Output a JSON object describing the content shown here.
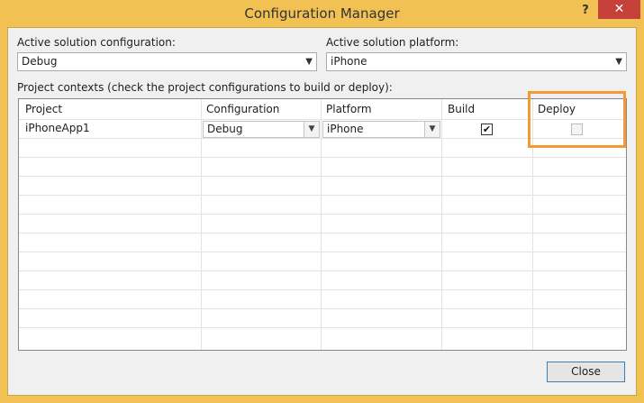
{
  "window": {
    "title": "Configuration Manager",
    "help_label": "?",
    "close_label": "✕"
  },
  "solution": {
    "config_label": "Active solution configuration:",
    "config_value": "Debug",
    "platform_label": "Active solution platform:",
    "platform_value": "iPhone"
  },
  "contexts": {
    "label": "Project contexts (check the project configurations to build or deploy):",
    "columns": [
      "Project",
      "Configuration",
      "Platform",
      "Build",
      "Deploy"
    ],
    "rows": [
      {
        "project": "iPhoneApp1",
        "configuration": "Debug",
        "platform": "iPhone",
        "build": true,
        "deploy": false
      }
    ]
  },
  "footer": {
    "close_button": "Close"
  }
}
